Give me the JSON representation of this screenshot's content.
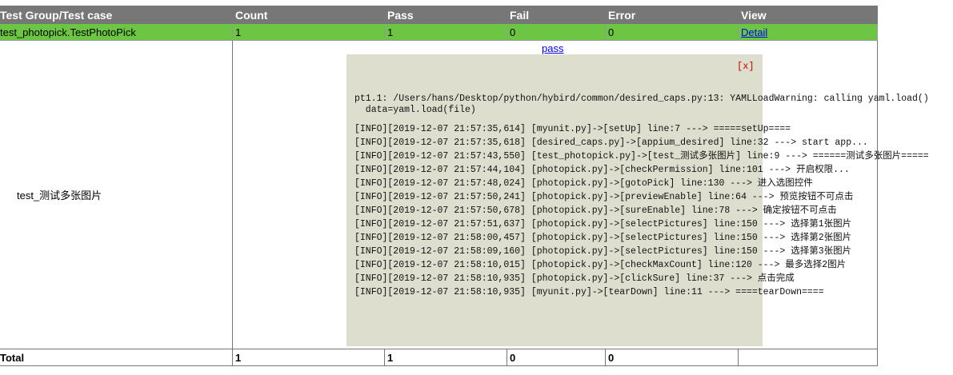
{
  "table": {
    "headers": [
      "Test Group/Test case",
      "Count",
      "Pass",
      "Fail",
      "Error",
      "View"
    ],
    "group_row": {
      "name": "test_photopick.TestPhotoPick",
      "count": "1",
      "pass": "1",
      "fail": "0",
      "error": "0",
      "view": "Detail"
    },
    "case_row": {
      "name": "test_测试多张图片",
      "status_link": "pass"
    },
    "total_row": {
      "label": "Total",
      "count": "1",
      "pass": "1",
      "fail": "0",
      "error": "0"
    }
  },
  "popup": {
    "close_label": "[x]",
    "warning_line1": "pt1.1: /Users/hans/Desktop/python/hybird/common/desired_caps.py:13: YAMLLoadWarning: calling yaml.load()",
    "warning_line2": "  data=yaml.load(file)",
    "log_lines": [
      "[INFO][2019-12-07 21:57:35,614] [myunit.py]->[setUp] line:7 ---> =====setUp====",
      "[INFO][2019-12-07 21:57:35,618] [desired_caps.py]->[appium_desired] line:32 ---> start app...",
      "[INFO][2019-12-07 21:57:43,550] [test_photopick.py]->[test_测试多张图片] line:9 ---> ======测试多张图片=====",
      "[INFO][2019-12-07 21:57:44,104] [photopick.py]->[checkPermission] line:101 ---> 开启权限...",
      "[INFO][2019-12-07 21:57:48,024] [photopick.py]->[gotoPick] line:130 ---> 进入选图控件",
      "[INFO][2019-12-07 21:57:50,241] [photopick.py]->[previewEnable] line:64 ---> 预览按钮不可点击",
      "[INFO][2019-12-07 21:57:50,678] [photopick.py]->[sureEnable] line:78 ---> 确定按钮不可点击",
      "[INFO][2019-12-07 21:57:51,637] [photopick.py]->[selectPictures] line:150 ---> 选择第1张图片",
      "[INFO][2019-12-07 21:58:00,457] [photopick.py]->[selectPictures] line:150 ---> 选择第2张图片",
      "[INFO][2019-12-07 21:58:09,160] [photopick.py]->[selectPictures] line:150 ---> 选择第3张图片",
      "[INFO][2019-12-07 21:58:10,015] [photopick.py]->[checkMaxCount] line:120 ---> 最多选择2图片",
      "[INFO][2019-12-07 21:58:10,935] [photopick.py]->[clickSure] line:37 ---> 点击完成",
      "[INFO][2019-12-07 21:58:10,935] [myunit.py]->[tearDown] line:11 ---> ====tearDown===="
    ]
  },
  "colors": {
    "header_bg": "#777777",
    "pass_row_bg": "#6cc644",
    "popup_bg": "#dedecf",
    "link": "#0000ee",
    "close": "#cc0000"
  }
}
